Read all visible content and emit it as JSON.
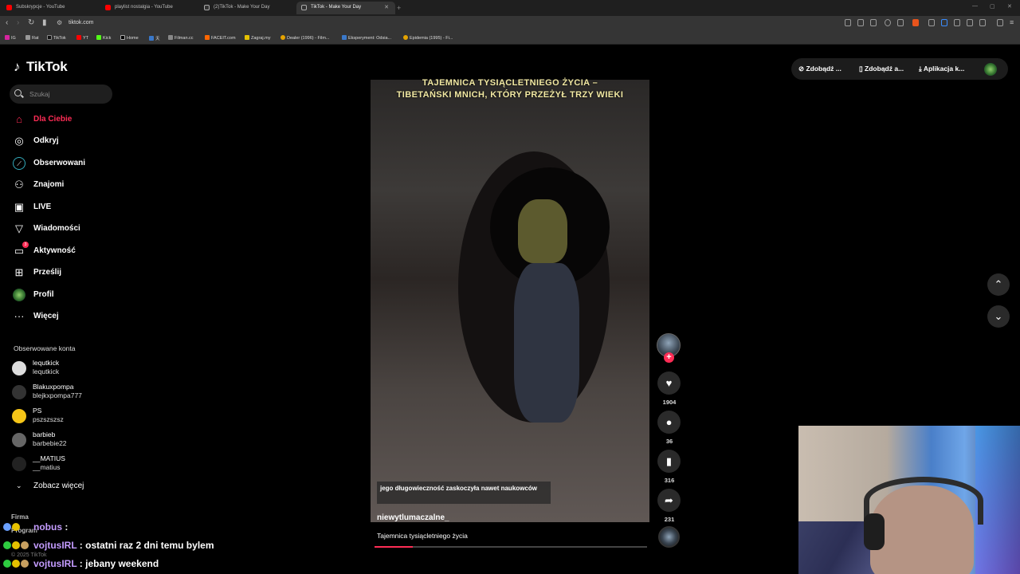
{
  "browser": {
    "tabs": [
      {
        "label": "Subskrypcje - YouTube",
        "color": "#ff0000",
        "active": false
      },
      {
        "label": "playlist nostalgia - YouTube",
        "color": "#ff0000",
        "active": false
      },
      {
        "label": "(2)TikTok - Make Your Day",
        "color": "#ffffff",
        "active": false
      },
      {
        "label": "TikTok - Make Your Day",
        "color": "#ffffff",
        "active": true
      }
    ],
    "url": "tiktok.com",
    "bookmarks": [
      "IG",
      "Rat",
      "TikTok",
      "YT",
      "Kick",
      "Home",
      "天",
      "Filman.cc",
      "FACEIT.com",
      "Zagraj.my",
      "Dealer (1996) - Film...",
      "Eksperyment: Odsia...",
      "Epidemia (1995) - Fi..."
    ]
  },
  "sidebar": {
    "logo": "TikTok",
    "search_placeholder": "Szukaj",
    "nav": [
      {
        "label": "Dla Ciebie",
        "icon": "home-icon",
        "active": true
      },
      {
        "label": "Odkryj",
        "icon": "compass-icon"
      },
      {
        "label": "Obserwowani",
        "icon": "following-icon"
      },
      {
        "label": "Znajomi",
        "icon": "friends-icon"
      },
      {
        "label": "LIVE",
        "icon": "live-icon"
      },
      {
        "label": "Wiadomości",
        "icon": "messages-icon"
      },
      {
        "label": "Aktywność",
        "icon": "activity-icon",
        "badge": "3"
      },
      {
        "label": "Prześlij",
        "icon": "upload-icon"
      },
      {
        "label": "Profil",
        "icon": "profile-icon"
      },
      {
        "label": "Więcej",
        "icon": "more-icon"
      }
    ],
    "followed_title": "Obserwowane konta",
    "followed": [
      {
        "name": "lequtkick",
        "handle": "lequtkick"
      },
      {
        "name": "Blakuxpompa",
        "handle": "blejkxpompa777"
      },
      {
        "name": "PS",
        "handle": "pszszszsz"
      },
      {
        "name": "barbieb",
        "handle": "barbebie22"
      },
      {
        "name": "__MATIUS",
        "handle": "__matius"
      }
    ],
    "see_more": "Zobacz więcej",
    "footer_company": "Firma",
    "footer_program": "Program",
    "copyright": "© 2025 TikTok"
  },
  "video": {
    "title_line1": "TAJEMNICA TYSIĄCLETNIEGO ŻYCIA –",
    "title_line2": "TIBETAŃSKI MNICH, KTÓRY PRZEŻYŁ TRZY WIEKI",
    "caption": "jego długowieczność zaskoczyła nawet naukowców",
    "author": "niewytlumaczalne_",
    "description": "Tajemnica tysiącletniego życia",
    "progress_fraction": 0.14
  },
  "actions": {
    "likes": "1904",
    "comments": "36",
    "saves": "316",
    "shares": "231"
  },
  "topbar": {
    "get_coins": "Zdobądź ...",
    "get_app": "Zdobądź a...",
    "desktop_app": "Aplikacja k..."
  },
  "chat": [
    {
      "user": "nobus",
      "message": ""
    },
    {
      "user": "vojtusIRL",
      "message": "ostatni raz 2 dni temu bylem"
    },
    {
      "user": "vojtusIRL",
      "message": "jebany weekend"
    }
  ]
}
